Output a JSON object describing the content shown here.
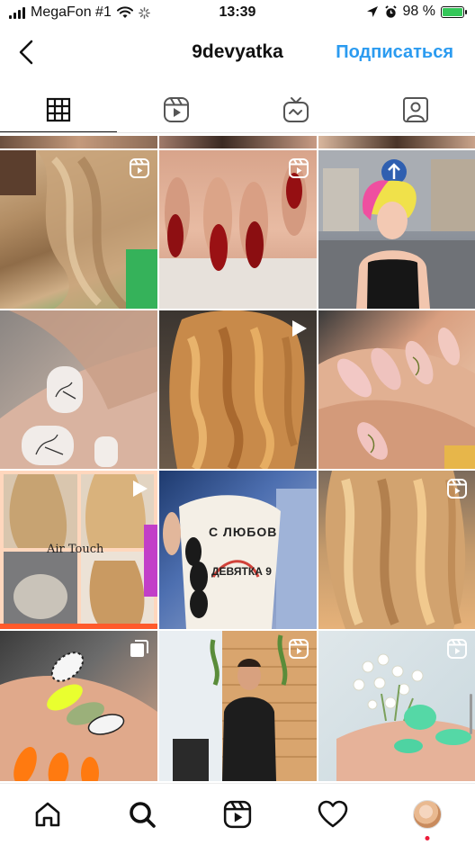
{
  "status": {
    "carrier": "MegaFon #1",
    "time": "13:39",
    "battery": "98 %",
    "battery_level": 0.98
  },
  "header": {
    "title": "9devyatka",
    "follow_label": "Подписаться",
    "back_icon": "chevron-left-icon"
  },
  "tabs": [
    {
      "icon": "grid-icon",
      "active": true
    },
    {
      "icon": "reels-icon",
      "active": false
    },
    {
      "icon": "igtv-icon",
      "active": false
    },
    {
      "icon": "tagged-icon",
      "active": false
    }
  ],
  "grid": {
    "rows": [
      [
        "Hair waves back",
        "Red nails",
        "Pink-yellow haircut"
      ],
      [
        "Nail art line drawing",
        "Curly hair",
        "Floral nails"
      ],
      [
        "Air Touch collage",
        "Coffee cup nails",
        "Wavy blonde hair"
      ],
      [
        "Neon nails",
        "Barber man",
        "Flowers mint nails"
      ]
    ],
    "collage_text": "Air Touch",
    "cup_text": [
      "С ЛЮБОВ",
      "ДЕВЯТКА 9"
    ]
  },
  "nav": [
    {
      "icon": "home-icon"
    },
    {
      "icon": "search-icon",
      "active": true
    },
    {
      "icon": "reels-icon"
    },
    {
      "icon": "heart-icon"
    },
    {
      "icon": "profile-avatar"
    }
  ],
  "colors": {
    "accent": "#2b9bf0",
    "notification": "#ed1c3a"
  }
}
